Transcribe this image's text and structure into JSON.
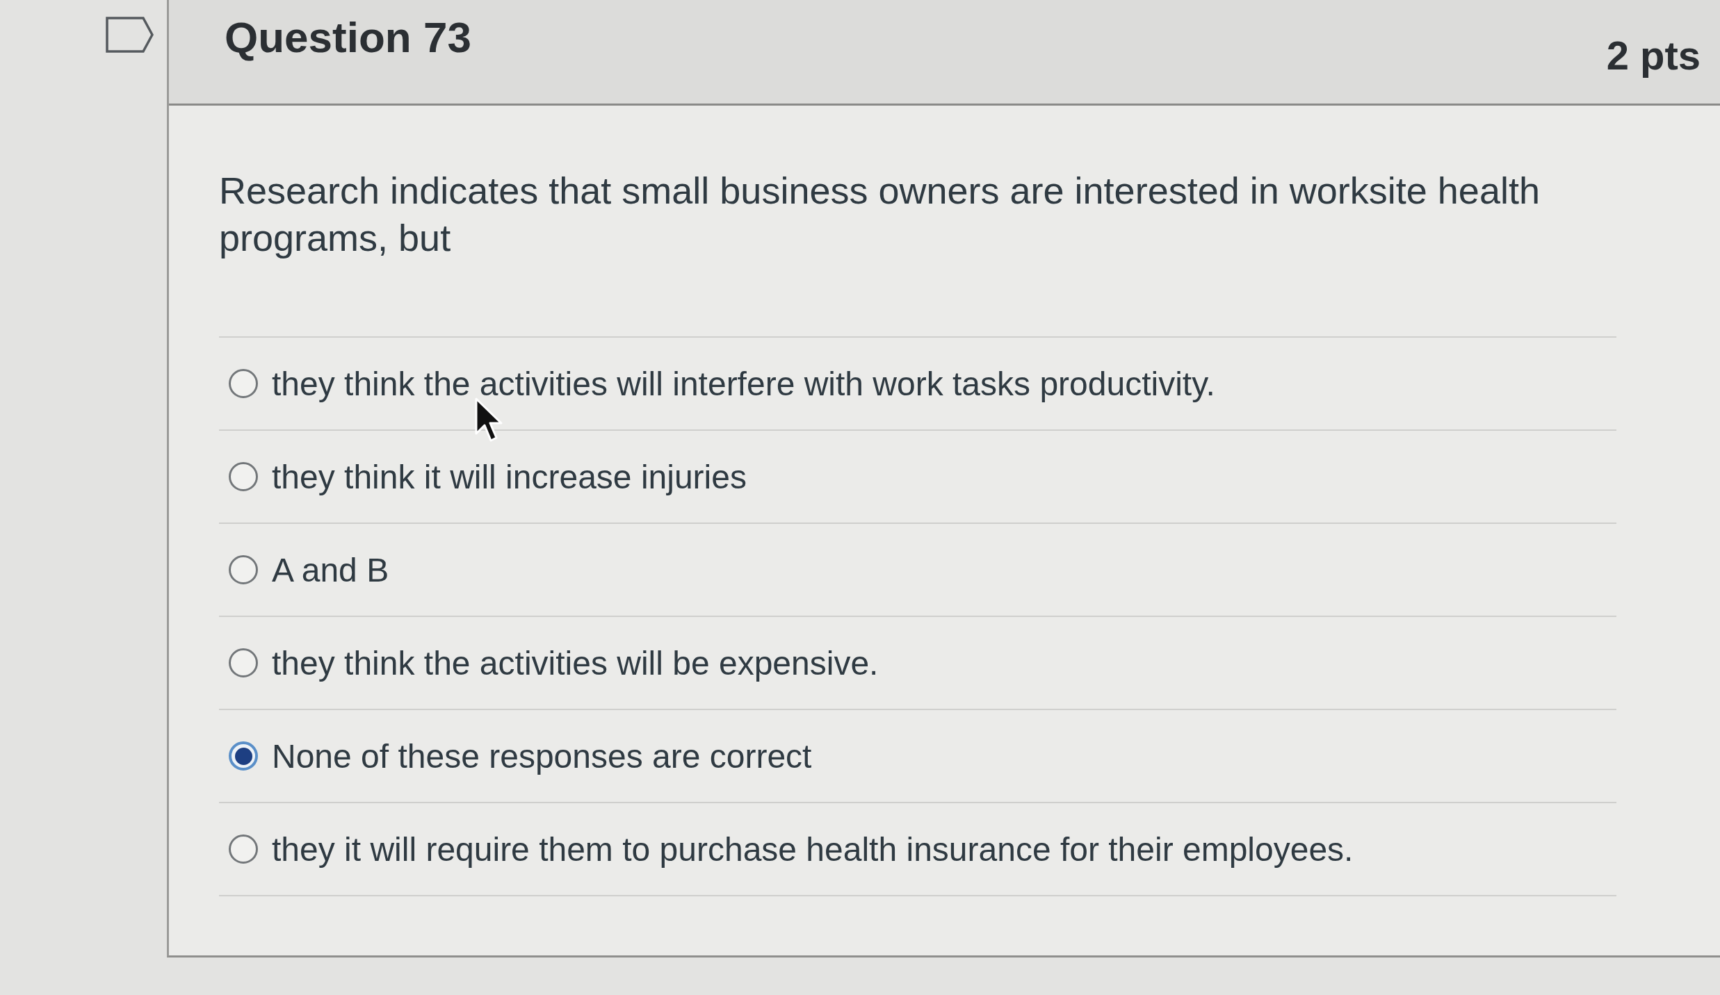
{
  "question": {
    "title": "Question 73",
    "points": "2 pts",
    "text": "Research indicates that small business owners are interested in worksite health programs, but",
    "answers": [
      {
        "label": "they think the activities will interfere with work tasks productivity.",
        "selected": false
      },
      {
        "label": "they think it will increase injuries",
        "selected": false
      },
      {
        "label": "A and B",
        "selected": false
      },
      {
        "label": "they think the activities will be expensive.",
        "selected": false
      },
      {
        "label": "None of these responses are correct",
        "selected": true
      },
      {
        "label": "they it will require them to purchase health insurance for their employees.",
        "selected": false
      }
    ]
  }
}
